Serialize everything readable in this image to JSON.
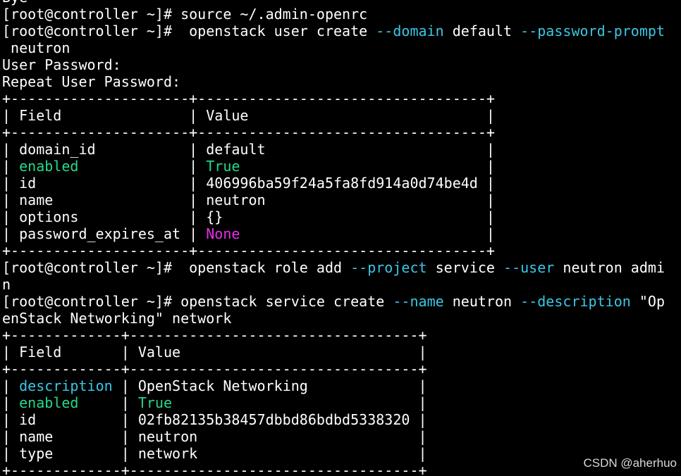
{
  "colors": {
    "background": "#000000",
    "text": "#ffffff",
    "flag": "#3cc6e6",
    "green": "#25d98a",
    "magenta": "#e630e6",
    "watermark": "#d8d8d8"
  },
  "terminal": {
    "lines": [
      [
        {
          "t": "Bye",
          "c": "normal"
        }
      ],
      [
        {
          "t": "[root@controller ~]# source ~/.admin-openrc",
          "c": "normal"
        }
      ],
      [
        {
          "t": "[root@controller ~]#  openstack user create ",
          "c": "normal"
        },
        {
          "t": "--domain",
          "c": "flag"
        },
        {
          "t": " default ",
          "c": "normal"
        },
        {
          "t": "--password-prompt",
          "c": "flag"
        }
      ],
      [
        {
          "t": " neutron",
          "c": "normal"
        }
      ],
      [
        {
          "t": "User Password:",
          "c": "normal"
        }
      ],
      [
        {
          "t": "Repeat User Password:",
          "c": "normal"
        }
      ],
      [
        {
          "t": "+---------------------+----------------------------------+",
          "c": "normal"
        }
      ],
      [
        {
          "t": "| Field               | Value                            |",
          "c": "normal"
        }
      ],
      [
        {
          "t": "+---------------------+----------------------------------+",
          "c": "normal"
        }
      ],
      [
        {
          "t": "| domain_id           | default                          |",
          "c": "normal"
        }
      ],
      [
        {
          "t": "| ",
          "c": "normal"
        },
        {
          "t": "enabled",
          "c": "green"
        },
        {
          "t": "             | ",
          "c": "normal"
        },
        {
          "t": "True",
          "c": "green"
        },
        {
          "t": "                             |",
          "c": "normal"
        }
      ],
      [
        {
          "t": "| id                  | 406996ba59f24a5fa8fd914a0d74be4d |",
          "c": "normal"
        }
      ],
      [
        {
          "t": "| name                | neutron                          |",
          "c": "normal"
        }
      ],
      [
        {
          "t": "| options             | {}                               |",
          "c": "normal"
        }
      ],
      [
        {
          "t": "| password_expires_at | ",
          "c": "normal"
        },
        {
          "t": "None",
          "c": "magenta"
        },
        {
          "t": "                             |",
          "c": "normal"
        }
      ],
      [
        {
          "t": "+---------------------+----------------------------------+",
          "c": "normal"
        }
      ],
      [
        {
          "t": "[root@controller ~]#  openstack role add ",
          "c": "normal"
        },
        {
          "t": "--project",
          "c": "flag"
        },
        {
          "t": " service ",
          "c": "normal"
        },
        {
          "t": "--user",
          "c": "flag"
        },
        {
          "t": " neutron admi",
          "c": "normal"
        }
      ],
      [
        {
          "t": "n",
          "c": "normal"
        }
      ],
      [
        {
          "t": "[root@controller ~]# openstack service create ",
          "c": "normal"
        },
        {
          "t": "--name",
          "c": "flag"
        },
        {
          "t": " neutron ",
          "c": "normal"
        },
        {
          "t": "--description",
          "c": "flag"
        },
        {
          "t": " \"Op",
          "c": "normal"
        }
      ],
      [
        {
          "t": "enStack Networking\" network",
          "c": "normal"
        }
      ],
      [
        {
          "t": "+-------------+----------------------------------+",
          "c": "normal"
        }
      ],
      [
        {
          "t": "| Field       | Value                            |",
          "c": "normal"
        }
      ],
      [
        {
          "t": "+-------------+----------------------------------+",
          "c": "normal"
        }
      ],
      [
        {
          "t": "| ",
          "c": "normal"
        },
        {
          "t": "description",
          "c": "flag"
        },
        {
          "t": " | OpenStack Networking             |",
          "c": "normal"
        }
      ],
      [
        {
          "t": "| ",
          "c": "normal"
        },
        {
          "t": "enabled",
          "c": "green"
        },
        {
          "t": "     | ",
          "c": "normal"
        },
        {
          "t": "True",
          "c": "green"
        },
        {
          "t": "                             |",
          "c": "normal"
        }
      ],
      [
        {
          "t": "| id          | 02fb82135b38457dbbd86bdbd5338320 |",
          "c": "normal"
        }
      ],
      [
        {
          "t": "| name        | neutron                          |",
          "c": "normal"
        }
      ],
      [
        {
          "t": "| type        | network                          |",
          "c": "normal"
        }
      ],
      [
        {
          "t": "+-------------+----------------------------------+",
          "c": "normal"
        }
      ]
    ]
  },
  "watermark": "CSDN @aherhuo"
}
